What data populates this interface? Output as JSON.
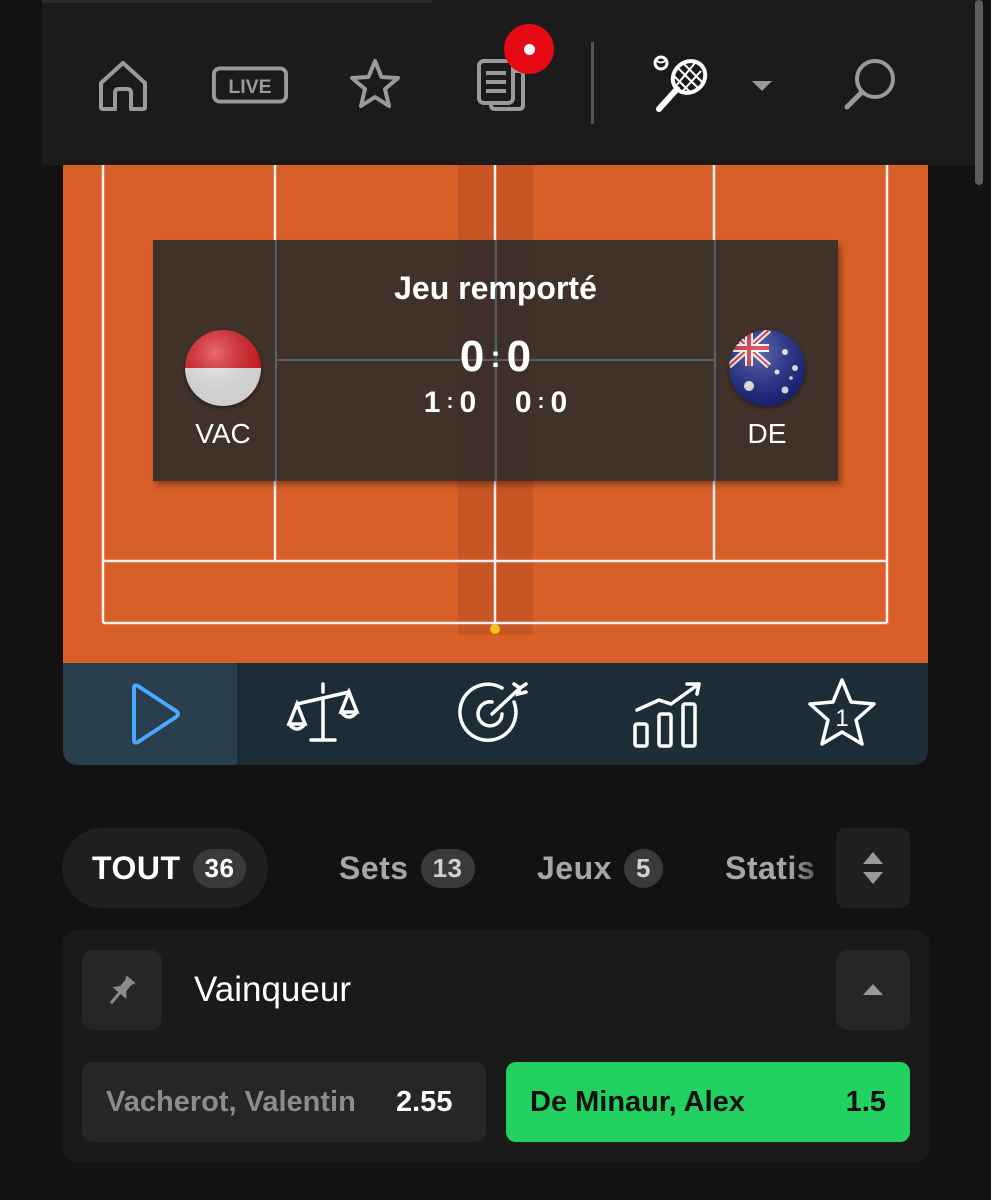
{
  "nav": {
    "items": [
      "home-icon",
      "live-icon",
      "star-icon",
      "betslip-icon",
      "tennis-icon",
      "dropdown-icon",
      "search-icon"
    ],
    "live_label": "LIVE",
    "notification_color": "#e50914"
  },
  "scoreboard": {
    "status": "Jeu remporté",
    "player1": {
      "code": "VAC",
      "flag": "monaco-flag"
    },
    "player2": {
      "code": "DE",
      "flag": "australia-flag"
    },
    "points": {
      "p1": "0",
      "p2": "0"
    },
    "sets": [
      {
        "p1": "1",
        "p2": "0"
      },
      {
        "p1": "0",
        "p2": "0"
      }
    ]
  },
  "toolbar": {
    "items": [
      "play-icon",
      "scales-icon",
      "target-icon",
      "stats-chart-icon",
      "rank-star-icon"
    ],
    "active": "play-icon",
    "rank_number": "1",
    "accent": "#4aa8ff"
  },
  "tabs": [
    {
      "label": "TOUT",
      "count": "36"
    },
    {
      "label": "Sets",
      "count": "13"
    },
    {
      "label": "Jeux",
      "count": "5"
    },
    {
      "label": "Statis"
    }
  ],
  "market": {
    "title": "Vainqueur",
    "outcomes": [
      {
        "name": "Vacherot, Valentin",
        "price": "2.55"
      },
      {
        "name": "De Minaur, Alex",
        "price": "1.5"
      }
    ],
    "selected_color": "#22d160"
  }
}
